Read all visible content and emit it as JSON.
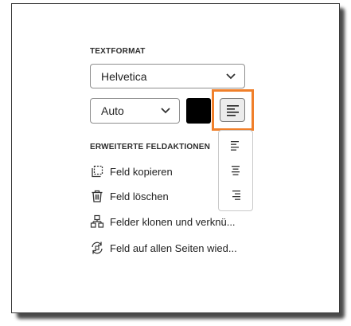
{
  "text_format": {
    "heading": "TEXTFORMAT",
    "font": "Helvetica",
    "size": "Auto",
    "color": "#000000",
    "align_button_icon": "align-left-icon",
    "highlight_color": "#f07f2a",
    "align_options": [
      {
        "icon": "align-left-icon"
      },
      {
        "icon": "align-center-icon"
      },
      {
        "icon": "align-right-icon"
      }
    ]
  },
  "advanced": {
    "heading": "ERWEITERTE FELDAKTIONEN",
    "actions": [
      {
        "label": "Feld kopieren",
        "icon": "copy-icon"
      },
      {
        "label": "Feld löschen",
        "icon": "trash-icon"
      },
      {
        "label": "Felder klonen und verknü...",
        "icon": "clone-link-icon"
      },
      {
        "label": "Feld auf allen Seiten wied...",
        "icon": "repeat-pages-icon"
      }
    ]
  }
}
